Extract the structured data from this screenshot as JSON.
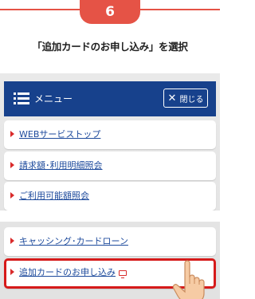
{
  "step": {
    "number": "6",
    "instruction": "「追加カードのお申し込み」を選択"
  },
  "colors": {
    "accent": "#e55346",
    "header": "#17418c",
    "link": "#1d4a9c",
    "highlight": "#d61a1a"
  },
  "menu": {
    "title": "メニュー",
    "close_label": "閉じる",
    "menu_icon": "hamburger-menu-icon",
    "close_icon": "close-x-icon"
  },
  "items_group1": [
    {
      "label": "WEBサービストップ"
    },
    {
      "label": "請求額･利用明細照会"
    },
    {
      "label": "ご利用可能額照会"
    }
  ],
  "items_group2": [
    {
      "label": "キャッシング･カードローン"
    },
    {
      "label": "追加カードのお申し込み",
      "icon": "screen-icon",
      "selected": true
    }
  ]
}
